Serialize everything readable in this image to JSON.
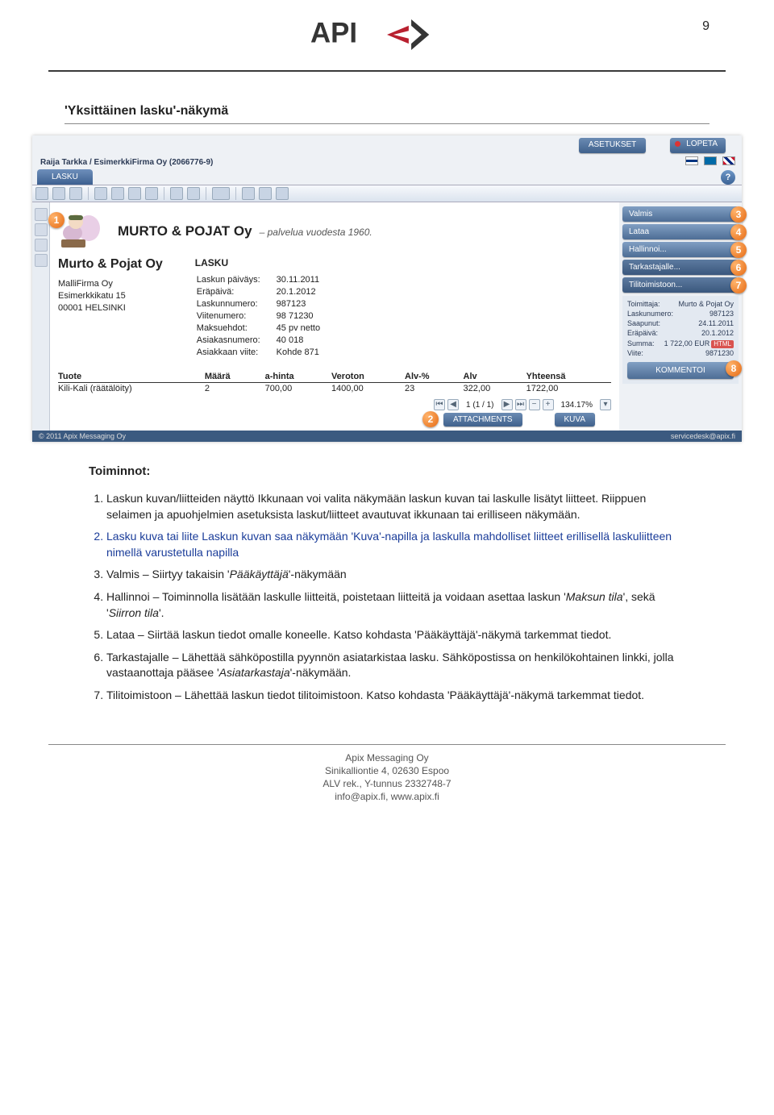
{
  "page_number": "9",
  "logo_text": "API",
  "section_title": "'Yksittäinen lasku'-näkymä",
  "shot": {
    "top_right": {
      "settings": "ASETUKSET",
      "quit": "LOPETA"
    },
    "user_line": "Raija Tarkka / EsimerkkiFirma Oy (2066776-9)",
    "tab_label": "LASKU",
    "brand_name": "MURTO & POJAT Oy",
    "brand_tagline": "– palvelua vuodesta 1960.",
    "company": {
      "name": "Murto & Pojat Oy",
      "line1": "MalliFirma Oy",
      "line2": "Esimerkkikatu 15",
      "line3": "00001 HELSINKI"
    },
    "invoice_head": "LASKU",
    "invoice_fields": [
      {
        "label": "Laskun päiväys:",
        "value": "30.11.2011"
      },
      {
        "label": "Eräpäivä:",
        "value": "20.1.2012"
      },
      {
        "label": "Laskunnumero:",
        "value": "987123"
      },
      {
        "label": "Viitenumero:",
        "value": "98 71230"
      },
      {
        "label": "Maksuehdot:",
        "value": "45 pv netto"
      },
      {
        "label": "Asiakasnumero:",
        "value": "40 018"
      },
      {
        "label": "Asiakkaan viite:",
        "value": "Kohde 871"
      }
    ],
    "columns": [
      "Tuote",
      "Määrä",
      "a-hinta",
      "Veroton",
      "Alv-%",
      "Alv",
      "Yhteensä"
    ],
    "row": [
      "Kili-Kali (räätälöity)",
      "2",
      "700,00",
      "1400,00",
      "23",
      "322,00",
      "1722,00"
    ],
    "pager": {
      "info": "1 (1 / 1)",
      "zoom": "134.17%"
    },
    "attachments_btn": "ATTACHMENTS",
    "kuva_btn": "KUVA",
    "right_buttons": [
      "Valmis",
      "Lataa",
      "Hallinnoi...",
      "Tarkastajalle...",
      "Tilitoimistoon..."
    ],
    "info": [
      {
        "l": "Toimittaja:",
        "v": "Murto & Pojat Oy"
      },
      {
        "l": "Laskunumero:",
        "v": "987123"
      },
      {
        "l": "Saapunut:",
        "v": "24.11.2011"
      },
      {
        "l": "Eräpäivä:",
        "v": "20.1.2012"
      },
      {
        "l": "Summa:",
        "v": "1 722,00 EUR"
      },
      {
        "l": "Viite:",
        "v": "9871230"
      }
    ],
    "kommentoi": "KOMMENTOI",
    "footer_left": "© 2011 Apix Messaging Oy",
    "footer_right": "servicedesk@apix.fi"
  },
  "toiminnot_heading": "Toiminnot:",
  "items": [
    "Laskun kuvan/liitteiden näyttö Ikkunaan voi valita näkymään laskun kuvan tai laskulle lisätyt liitteet. Riippuen selaimen ja apuohjelmien asetuksista laskut/liitteet avautuvat ikkunaan tai erilliseen näkymään.",
    "Lasku kuva tai liite Laskun kuvan saa näkymään 'Kuva'-napilla ja laskulla mahdolliset liitteet erillisellä laskuliitteen nimellä varustetulla napilla",
    "Valmis – Siirtyy takaisin 'Pääkäyttäjä'-näkymään",
    "Hallinnoi – Toiminnolla lisätään laskulle liitteitä, poistetaan liitteitä ja voidaan asettaa laskun 'Maksun tila', sekä 'Siirron tila'.",
    "Lataa – Siirtää laskun tiedot omalle koneelle. Katso kohdasta 'Pääkäyttäjä'-näkymä tarkemmat tiedot.",
    "Tarkastajalle – Lähettää sähköpostilla pyynnön asiatarkistaa lasku. Sähköpostissa on henkilökohtainen linkki, jolla vastaanottaja pääsee 'Asiatarkastaja'-näkymään.",
    "Tilitoimistoon – Lähettää laskun tiedot tilitoimistoon. Katso kohdasta 'Pääkäyttäjä'-näkymä tarkemmat tiedot."
  ],
  "footer": {
    "l1": "Apix Messaging Oy",
    "l2": "Sinikalliontie 4, 02630 Espoo",
    "l3": "ALV rek., Y-tunnus 2332748-7",
    "l4": "info@apix.fi, www.apix.fi"
  }
}
